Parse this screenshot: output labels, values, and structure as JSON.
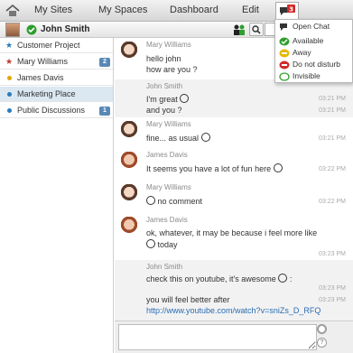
{
  "nav": {
    "items": [
      "My Sites",
      "My Spaces",
      "Dashboard",
      "Edit"
    ],
    "chat_badge": "3"
  },
  "user": {
    "name": "John Smith",
    "search_placeholder": ""
  },
  "sidebar": {
    "items": [
      {
        "label": "Customer Project",
        "marker": "star",
        "color": "#2a7bbf",
        "badge": ""
      },
      {
        "label": "Mary Williams",
        "marker": "star",
        "color": "#c0392b",
        "badge": "2"
      },
      {
        "label": "James Davis",
        "marker": "dot",
        "color": "#e0a800",
        "badge": ""
      },
      {
        "label": "Marketing Place",
        "marker": "dot",
        "color": "#2a7bbf",
        "badge": ""
      },
      {
        "label": "Public Discussions",
        "marker": "dot",
        "color": "#2a7bbf",
        "badge": "1"
      }
    ]
  },
  "messages": [
    {
      "author": "Mary Williams",
      "avatar": "mary",
      "lines": [
        "hello john",
        "how are you ?"
      ],
      "times": [
        "",
        ""
      ]
    },
    {
      "author": "John Smith",
      "avatar": "",
      "lines": [
        "I'm great",
        "and you ?"
      ],
      "times": [
        "03:21 PM",
        "03:21 PM"
      ]
    },
    {
      "author": "Mary Williams",
      "avatar": "mary",
      "lines": [
        "fine... as usual"
      ],
      "times": [
        "03:21 PM"
      ]
    },
    {
      "author": "James Davis",
      "avatar": "james",
      "lines": [
        "It seems you have a lot of fun here"
      ],
      "times": [
        "03:22 PM"
      ]
    },
    {
      "author": "Mary Williams",
      "avatar": "mary",
      "lines": [
        "no comment"
      ],
      "times": [
        "03:22 PM"
      ]
    },
    {
      "author": "James Davis",
      "avatar": "james",
      "lines": [
        "ok, whatever, it may be because i feel more like",
        "today"
      ],
      "times": [
        "03:23 PM"
      ]
    },
    {
      "author": "John Smith",
      "avatar": "",
      "lines": [
        "check this on youtube, it's awesome",
        ":",
        "you will feel better after"
      ],
      "times": [
        "03:23 PM",
        "03:23 PM"
      ],
      "link": "http://www.youtube.com/watch?v=sniZs_D_RFQ"
    }
  ],
  "status_menu": {
    "items": [
      {
        "label": "Open Chat",
        "icon": "open-chat-icon",
        "color": "#333333"
      },
      {
        "label": "Available",
        "icon": "available-icon",
        "color": "#2e9e2e"
      },
      {
        "label": "Away",
        "icon": "away-icon",
        "color": "#e6b800"
      },
      {
        "label": "Do not disturb",
        "icon": "do-not-disturb-icon",
        "color": "#d12b2b"
      },
      {
        "label": "Invisible",
        "icon": "invisible-icon",
        "color": "#2e9e2e"
      }
    ]
  },
  "colors": {
    "accent": "#2a6db3",
    "active_row": "#dbe8f2",
    "badge": "#5a88b6"
  }
}
